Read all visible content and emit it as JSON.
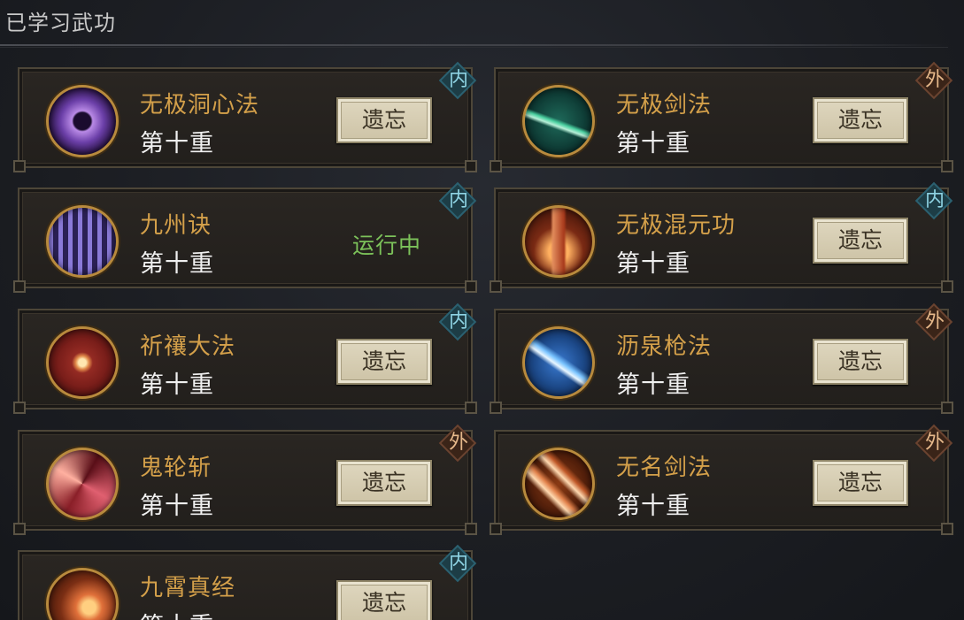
{
  "header": {
    "title": "已学习武功"
  },
  "skills": [
    {
      "name": "无极洞心法",
      "level": "第十重",
      "badge": "内",
      "action": "遗忘",
      "status": "",
      "icon": "purple-vortex-icon",
      "icon_color": "#6b3fa8"
    },
    {
      "name": "无极剑法",
      "level": "第十重",
      "badge": "外",
      "action": "遗忘",
      "status": "",
      "icon": "green-sword-icon",
      "icon_color": "#1e6a5a"
    },
    {
      "name": "九州诀",
      "level": "第十重",
      "badge": "内",
      "action": "",
      "status": "运行中",
      "icon": "purple-pillars-icon",
      "icon_color": "#3b2f6e"
    },
    {
      "name": "无极混元功",
      "level": "第十重",
      "badge": "内",
      "action": "遗忘",
      "status": "",
      "icon": "fire-pillar-icon",
      "icon_color": "#7a2a14"
    },
    {
      "name": "祈禳大法",
      "level": "第十重",
      "badge": "内",
      "action": "遗忘",
      "status": "",
      "icon": "red-star-icon",
      "icon_color": "#7a1e1a"
    },
    {
      "name": "沥泉枪法",
      "level": "第十重",
      "badge": "外",
      "action": "遗忘",
      "status": "",
      "icon": "blue-spear-icon",
      "icon_color": "#1d4a8a"
    },
    {
      "name": "鬼轮斩",
      "level": "第十重",
      "badge": "外",
      "action": "遗忘",
      "status": "",
      "icon": "red-swirl-icon",
      "icon_color": "#8a1f28"
    },
    {
      "name": "无名剑法",
      "level": "第十重",
      "badge": "外",
      "action": "遗忘",
      "status": "",
      "icon": "orange-arrow-icon",
      "icon_color": "#8a3a14"
    },
    {
      "name": "九霄真经",
      "level": "第十重",
      "badge": "内",
      "action": "遗忘",
      "status": "",
      "icon": "flame-book-icon",
      "icon_color": "#7a2e14"
    }
  ],
  "colors": {
    "name": "#d4a04a",
    "level": "#f0f0f0",
    "running": "#7cc25a",
    "nei_badge": "#8fd4e4",
    "wai_badge": "#e6b88a"
  }
}
